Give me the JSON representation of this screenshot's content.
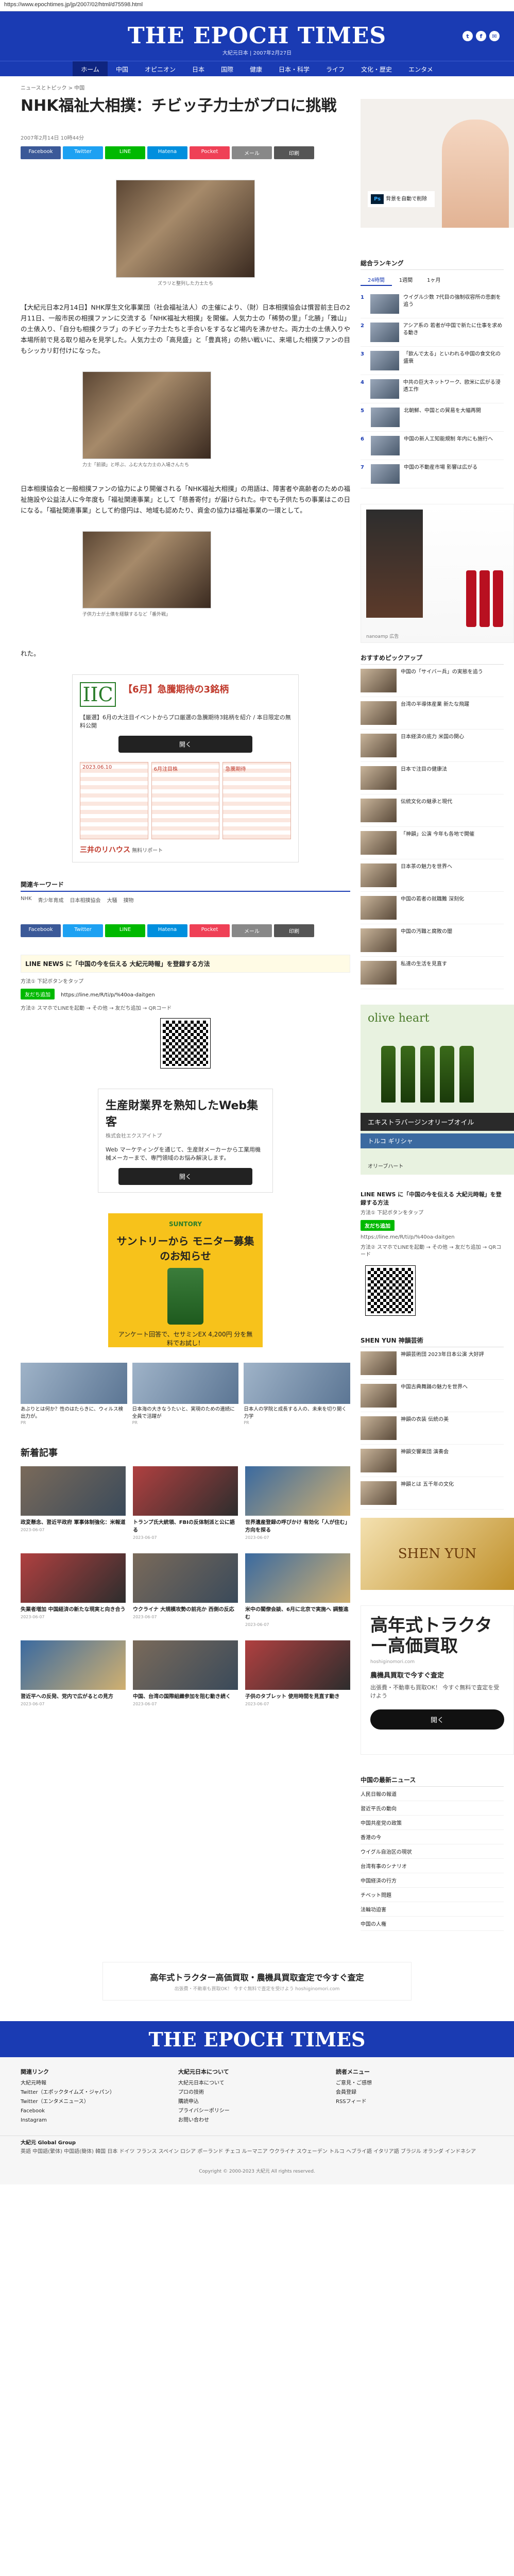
{
  "url": "https://www.epochtimes.jp/jp/2007/02/html/d75598.html",
  "header": {
    "logo": "THE EPOCH TIMES",
    "logo_sub": "大紀元日本 | 2007年2月27日",
    "social": [
      "t",
      "f",
      "✉"
    ]
  },
  "nav": [
    "ホーム",
    "中国",
    "オピニオン",
    "日本",
    "国際",
    "健康",
    "日本・科学",
    "ライフ",
    "文化・歴史",
    "エンタメ"
  ],
  "breadcrumb": "ニュースとトピック  >  中国",
  "article": {
    "title": "NHK福祉大相撲：チビッ子力士がプロに挑戦",
    "meta": "2007年2月14日 10時44分",
    "share": [
      "Facebook",
      "Twitter",
      "LINE",
      "Hatena",
      "Pocket",
      "メール",
      "印刷"
    ],
    "photo1_caption": "ズラリと整列した力士たち",
    "para1": "【大紀元日本2月14日】NHK厚生文化事業団（社会福祉法人）の主催により、（財）日本相撲協会は慣習前主日の2月11日、一般市民の相撲ファンに交流する「NHK福祉大相撲」を開催。人気力士の「稀勢の里」「北勝」「雅山」の土俵入り、「自分も相撲クラブ」のチビッ子力士たちと手合いをするなど場内を沸かせた。両力士の土俵入りや本場所前で見る取り組みを見学した。人気力士の「高見盛」と「豊真将」の熱い戦いに、来場した相撲ファンの目もシッカリ釘付けになった。",
    "photo2_caption": "力士「前頭」と呼ぶ、ふむ大な力士の入場さんたち",
    "para2": "日本相撲協会と一般相撲ファンの協力により開催される「NHK福祉大相撲」の用語は、障害者や高齢者のための福祉施設や公益法人に今年度も「福祉関連事業」として「慈善寄付」が届けられた。中でも子供たちの事業はこの日になる。「福祉関連事業」として約億円は、地域も認めたり、資金の協力は福祉事業の一環として。",
    "photo3_caption": "子供力士が土俵を経験するなど「番外戦」",
    "para3": "れた。"
  },
  "ad1": {
    "logo": "IIC",
    "headline": "【6月】急騰期待の3銘柄",
    "body": "【厳選】6月の大注目イベントからプロ厳選の急騰期待3銘柄を紹介 / 本日限定の無料公開",
    "button": "開く",
    "grid": [
      "2023.06.10",
      "6月注目株",
      "急騰期待"
    ],
    "footer_brand": "三井のリハウス",
    "footer_tag": "無料リポート"
  },
  "related": {
    "heading": "関連キーワード",
    "tags": [
      "NHK",
      "青少年育成",
      "日本相撲協会",
      "大騒",
      "撲物"
    ]
  },
  "line_box": {
    "title": "LINE NEWS に「中国の今を伝える 大紀元時報」を登録する方法",
    "sub1": "方法①  下記ボタンをタップ",
    "add": "友だち追加",
    "url": "https://line.me/R/ti/p/%40oa-daitgen",
    "sub2": "方法②  スマホでLINEを起動 → その他 → 友だち追加 → QRコード"
  },
  "ad2": {
    "title": "生産財業界を熟知したWeb集客",
    "tiny": "株式会社エクスアイトプ",
    "body": "Web マーケティングを通じて、生産財メーカーから工業用機械メーカーまで、専門領域のお悩み解決します。",
    "button": "開く"
  },
  "ad3": {
    "brand": "SUNTORY",
    "big": "サントリーから モニター募集のお知らせ",
    "prize": "アンケート回答で、セサミンEX 4,200円 分を無料でお試し！"
  },
  "reco": [
    {
      "cap": "あぶりとは何か？性のはたらきに、ウィルス検出力が。",
      "src": "PR"
    },
    {
      "cap": "日本海の大きなうたいと、実現のための連続に全員で活躍が",
      "src": "PR"
    },
    {
      "cap": "日本人の学院と成長する人の、未来を切り開く力学",
      "src": "PR"
    }
  ],
  "latest_heading": "新着記事",
  "latest": [
    {
      "cap": "政変懸念、習近平政府 軍事体制強化：米報道",
      "date": "2023-06-07"
    },
    {
      "cap": "トランプ氏大統領、FBIの反体制派と公に語る",
      "date": "2023-06-07"
    },
    {
      "cap": "世界遺産登録の呼びかけ 有効化「人が住む」方向を探る",
      "date": "2023-06-07"
    },
    {
      "cap": "失業者増加 中国経済の新たな現実と向き合う",
      "date": "2023-06-07"
    },
    {
      "cap": "ウクライナ 大規模攻勢の前兆か 西側の反応",
      "date": "2023-06-07"
    },
    {
      "cap": "米中の閣僚会談、6月に北京で実施へ 調整進む",
      "date": "2023-06-07"
    },
    {
      "cap": "習近平への反発、党内で広がるとの見方",
      "date": "2023-06-07"
    },
    {
      "cap": "中国、台湾の国際組織参加を阻む動き続く",
      "date": "2023-06-07"
    },
    {
      "cap": "子供のタブレット 使用時間を見直す動き",
      "date": "2023-06-07"
    }
  ],
  "side": {
    "ad_label": "Ps",
    "ad_text": "背景を自動で削除",
    "rank_heading": "総合ランキング",
    "rank_tabs": [
      "24時間",
      "1週間",
      "1ヶ月"
    ],
    "rank": [
      "ウイグル少数 7代目の強制収容所の悲劇を追う",
      "アシア系の 若者が中国で新たに仕事を求める動き",
      "「飲んで太る」といわれる中国の食文化の盛衰",
      "中共の巨大ネットワーク、欧米に広がる浸透工作",
      "北朝鮮、中国との貿易を大幅再開",
      "中国の新人工知能規制 年内にも施行へ",
      "中国の不動産市場 影響は広がる"
    ],
    "ad2_caption": "nanoamp 広告",
    "pick_heading": "おすすめピックアップ",
    "pick": [
      "中国の「サイバー兵」の実態を追う",
      "台湾の半導体産業 新たな飛躍",
      "日本経済の底力 米国の関心",
      "日本で注目の健康法",
      "伝統文化の継承と現代",
      "「神韻」公演 今年も各地で開催",
      "日本茶の魅力を世界へ",
      "中国の若者の就職難 深刻化",
      "中国の汚職と腐敗の闇",
      "私達の生活を見直す"
    ],
    "olive_brand": "olive heart",
    "olive_band": "エキストラバージンオリーブオイル",
    "olive_band2": "トルコ ギリシャ",
    "olive_foot": "オリーブハート",
    "line_title": "LINE NEWS に「中国の今を伝える 大紀元時報」を登録する方法",
    "line_sub1": "方法①  下記ボタンをタップ",
    "line_add": "友だち追加",
    "line_url": "https://line.me/R/ti/p/%40oa-daitgen",
    "line_sub2": "方法②  スマホでLINEを起動 → その他 → 友だち追加 → QRコード",
    "shen_heading": "SHEN YUN 神韻芸術",
    "shen": [
      "神韻芸術団 2023年日本公演 大好評",
      "中国古典舞踊の魅力を世界へ",
      "神韻の衣装 伝統の美",
      "神韻交響楽団 演奏会",
      "神韻とは 五千年の文化"
    ],
    "shen_banner": "SHEN YUN",
    "tractor_title": "高年式トラクター高価買取",
    "tractor_src": "hoshiginomori.com",
    "tractor_m": "農機具買取で今すぐ査定",
    "tractor_d": "出張費・不動車も買取OK！ 今すぐ無料で査定を受けよう",
    "tractor_btn": "開く",
    "china_heading": "中国の最新ニュース",
    "china": [
      "人民日報の報道",
      "習近平氏の動向",
      "中国共産党の政策",
      "香港の今",
      "ウイグル自治区の現状",
      "台湾有事のシナリオ",
      "中国経済の行方",
      "チベット問題",
      "法輪功迫害",
      "中国の人権"
    ],
    "arrow": "›"
  },
  "bottom_ad": {
    "title": "高年式トラクター高価買取・農機具買取査定で今すぐ査定",
    "sub": "出張費・不動車も買取OK！ 今すぐ無料で査定を受けよう  hoshiginomori.com"
  },
  "footer": {
    "logo": "THE EPOCH TIMES",
    "col1_h": "関連リンク",
    "col1": [
      "大紀元時報",
      "Twitter（エポックタイムズ・ジャパン）",
      "Twitter（エンタメニュース）",
      "Facebook",
      "Instagram"
    ],
    "col2_h": "大紀元日本について",
    "col2": [
      "大紀元日本について",
      "プロの技術",
      "購読申込",
      "プライバシーポリシー",
      "お問い合わせ"
    ],
    "col3_h": "読者メニュー",
    "col3": [
      "ご意見・ご感想",
      "会員登録",
      "RSSフィード"
    ],
    "global_h": "大紀元 Global Group",
    "global": "英語 中国語(繁体) 中国語(簡体) 韓国 日本 ドイツ フランス スペイン ロシア ポーランド チェコ ルーマニア ウクライナ スウェーデン トルコ ヘブライ語 イタリア語 ブラジル オランダ インドネシア",
    "copyright": "Copyright © 2000-2023 大紀元  All rights reserved."
  }
}
